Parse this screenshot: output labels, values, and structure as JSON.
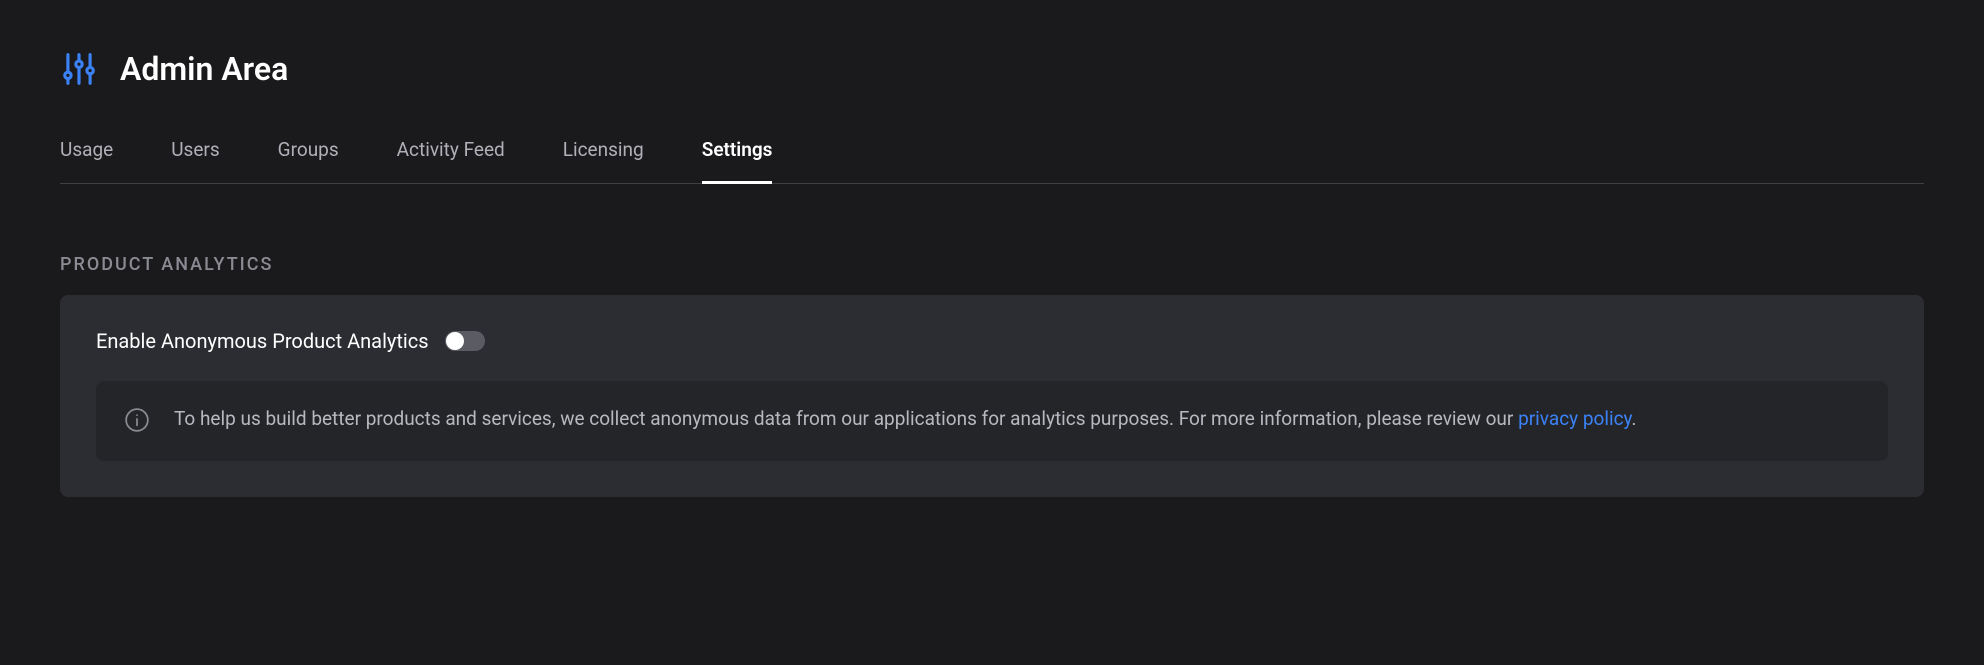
{
  "header": {
    "title": "Admin Area"
  },
  "tabs": {
    "usage": "Usage",
    "users": "Users",
    "groups": "Groups",
    "activity_feed": "Activity Feed",
    "licensing": "Licensing",
    "settings": "Settings",
    "active": "settings"
  },
  "section": {
    "title": "Product Analytics",
    "setting_label": "Enable Anonymous Product Analytics",
    "toggle_state": false,
    "info_text_pre": "To help us build better products and services, we collect anonymous data from our applications for analytics purposes. For more information, please review our ",
    "info_link_text": "privacy policy",
    "info_text_post": "."
  },
  "colors": {
    "accent": "#3b82f6"
  }
}
